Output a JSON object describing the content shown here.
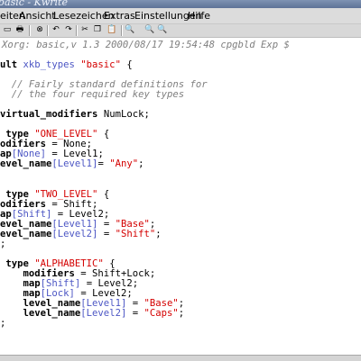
{
  "window": {
    "title": "basic - Kwrite"
  },
  "menu": [
    {
      "label": "eiten",
      "name": "menu-datei"
    },
    {
      "label": "Ansicht",
      "name": "menu-ansicht"
    },
    {
      "label": "Lesezeichen",
      "name": "menu-lesezeichen"
    },
    {
      "label": "Extras",
      "name": "menu-extras"
    },
    {
      "label": "Einstellungen",
      "name": "menu-einstellungen"
    },
    {
      "label": "Hilfe",
      "name": "menu-hilfe"
    }
  ],
  "toolbar": {
    "buttons": [
      {
        "icon": "open-icon",
        "glyph": "▭"
      },
      {
        "icon": "print-icon",
        "glyph": "🖶"
      },
      {
        "icon": "stop-icon",
        "glyph": "⊗"
      },
      {
        "icon": "undo-icon",
        "glyph": "↶"
      },
      {
        "icon": "redo-icon",
        "glyph": "↷"
      },
      {
        "icon": "cut-icon",
        "glyph": "✂"
      },
      {
        "icon": "copy-icon",
        "glyph": "❐"
      },
      {
        "icon": "paste-icon",
        "glyph": "📋"
      },
      {
        "icon": "find-icon",
        "glyph": "🔍"
      },
      {
        "icon": "find-next-icon",
        "glyph": "🔍"
      },
      {
        "icon": "find-prev-icon",
        "glyph": "🔍"
      }
    ]
  },
  "editor": {
    "lines": [
      [
        {
          "t": "Xorg: basic,v 1.3 2000/08/17 19:54:48 cpgbld Exp $",
          "c": "cm"
        }
      ],
      [],
      [
        {
          "t": "ult ",
          "c": "kw"
        },
        {
          "t": "xkb_types ",
          "c": "dim"
        },
        {
          "t": "\"basic\"",
          "c": "str"
        },
        {
          "t": " {",
          "c": ""
        }
      ],
      [],
      [
        {
          "t": "  // Fairly standard definitions for",
          "c": "cm"
        }
      ],
      [
        {
          "t": "  // the four required key types",
          "c": "cm"
        }
      ],
      [],
      [
        {
          "t": "virtual_modifiers ",
          "c": "kw"
        },
        {
          "t": "NumLock;",
          "c": ""
        }
      ],
      [],
      [
        {
          "t": " type ",
          "c": "kw"
        },
        {
          "t": "\"ONE_LEVEL\"",
          "c": "str"
        },
        {
          "t": " {",
          "c": ""
        }
      ],
      [
        {
          "t": "odifiers",
          "c": "kw"
        },
        {
          "t": " = None;",
          "c": ""
        }
      ],
      [
        {
          "t": "ap",
          "c": "kw"
        },
        {
          "t": "[None]",
          "c": "dim"
        },
        {
          "t": " = Level1;",
          "c": ""
        }
      ],
      [
        {
          "t": "evel_name",
          "c": "kw"
        },
        {
          "t": "[Level1]",
          "c": "dim"
        },
        {
          "t": "= ",
          "c": ""
        },
        {
          "t": "\"Any\"",
          "c": "str"
        },
        {
          "t": ";",
          "c": ""
        }
      ],
      [],
      [],
      [
        {
          "t": " type ",
          "c": "kw"
        },
        {
          "t": "\"TWO_LEVEL\"",
          "c": "str"
        },
        {
          "t": " {",
          "c": ""
        }
      ],
      [
        {
          "t": "odifiers",
          "c": "kw"
        },
        {
          "t": " = Shift;",
          "c": ""
        }
      ],
      [
        {
          "t": "ap",
          "c": "kw"
        },
        {
          "t": "[Shift]",
          "c": "dim"
        },
        {
          "t": " = Level2;",
          "c": ""
        }
      ],
      [
        {
          "t": "evel_name",
          "c": "kw"
        },
        {
          "t": "[Level1]",
          "c": "dim"
        },
        {
          "t": " = ",
          "c": ""
        },
        {
          "t": "\"Base\"",
          "c": "str"
        },
        {
          "t": ";",
          "c": ""
        }
      ],
      [
        {
          "t": "evel_name",
          "c": "kw"
        },
        {
          "t": "[Level2]",
          "c": "dim"
        },
        {
          "t": " = ",
          "c": ""
        },
        {
          "t": "\"Shift\"",
          "c": "str"
        },
        {
          "t": ";",
          "c": ""
        }
      ],
      [
        {
          "t": ";",
          "c": ""
        }
      ],
      [],
      [
        {
          "t": " type ",
          "c": "kw"
        },
        {
          "t": "\"ALPHABETIC\"",
          "c": "str"
        },
        {
          "t": " {",
          "c": ""
        }
      ],
      [
        {
          "t": "    modifiers",
          "c": "kw"
        },
        {
          "t": " = Shift+Lock;",
          "c": ""
        }
      ],
      [
        {
          "t": "    map",
          "c": "kw"
        },
        {
          "t": "[Shift]",
          "c": "dim"
        },
        {
          "t": " = Level2;",
          "c": ""
        }
      ],
      [
        {
          "t": "    map",
          "c": "kw"
        },
        {
          "t": "[Lock]",
          "c": "dim"
        },
        {
          "t": " = Level2;",
          "c": ""
        }
      ],
      [
        {
          "t": "    level_name",
          "c": "kw"
        },
        {
          "t": "[Level1]",
          "c": "dim"
        },
        {
          "t": " = ",
          "c": ""
        },
        {
          "t": "\"Base\"",
          "c": "str"
        },
        {
          "t": ";",
          "c": ""
        }
      ],
      [
        {
          "t": "    level_name",
          "c": "kw"
        },
        {
          "t": "[Level2]",
          "c": "dim"
        },
        {
          "t": " = ",
          "c": ""
        },
        {
          "t": "\"Caps\"",
          "c": "str"
        },
        {
          "t": ";",
          "c": ""
        }
      ],
      [
        {
          "t": ";",
          "c": ""
        }
      ]
    ]
  }
}
